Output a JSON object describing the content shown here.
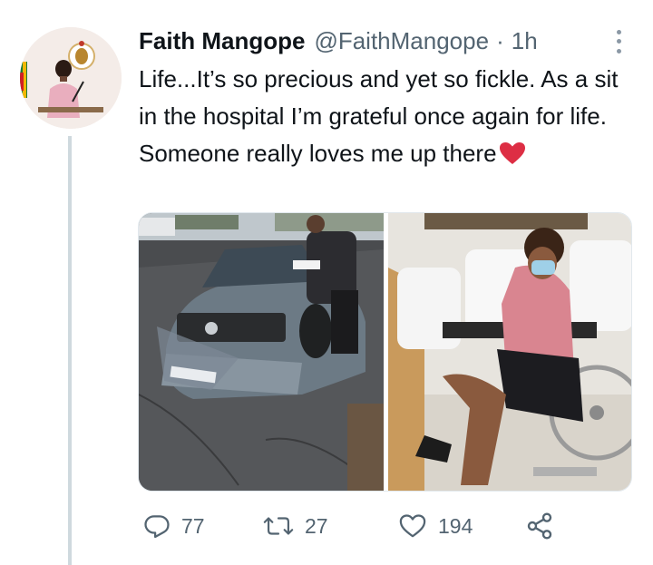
{
  "tweet": {
    "author_name": "Faith Mangope",
    "handle": "@FaithMangope",
    "separator": "·",
    "time": "1h",
    "text": "Life...It’s so precious and yet so fickle. As a sit in the hospital I’m grateful once again for life. Someone really loves me up there",
    "emoji": "red-heart"
  },
  "media": {
    "left_image": "crashed-car-photo",
    "right_image": "hospital-wheelchair-photo"
  },
  "actions": {
    "reply_count": "77",
    "retweet_count": "27",
    "like_count": "194"
  },
  "colors": {
    "text": "#0f1419",
    "secondary": "#536471",
    "thread_line": "#cfd9de",
    "heart": "#e0245e"
  }
}
